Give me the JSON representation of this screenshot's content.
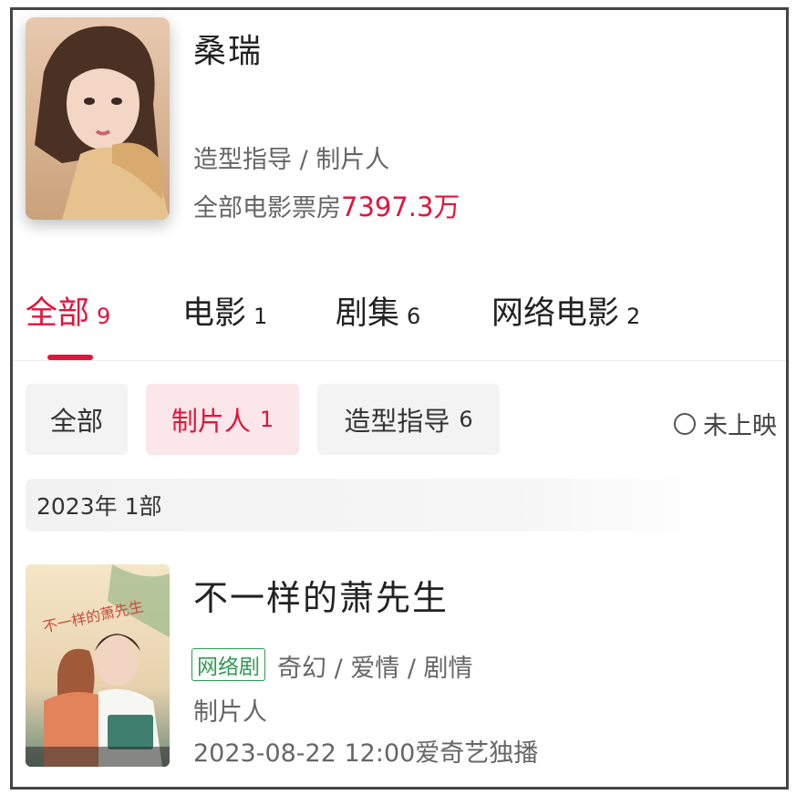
{
  "person": {
    "name": "桑瑞",
    "roles": "造型指导 / 制片人",
    "box_office_label": "全部电影票房",
    "box_office_value": "7397.3万"
  },
  "tabs": [
    {
      "label": "全部",
      "count": "9",
      "active": true
    },
    {
      "label": "电影",
      "count": "1",
      "active": false
    },
    {
      "label": "剧集",
      "count": "6",
      "active": false
    },
    {
      "label": "网络电影",
      "count": "2",
      "active": false
    }
  ],
  "filters": [
    {
      "label": "全部",
      "count": "",
      "active": false
    },
    {
      "label": "制片人",
      "count": "1",
      "active": true
    },
    {
      "label": "造型指导",
      "count": "6",
      "active": false
    }
  ],
  "unreleased_toggle": {
    "label": "未上映",
    "checked": false
  },
  "year_group": {
    "label": "2023年  1部"
  },
  "works": [
    {
      "title": "不一样的萧先生",
      "type_tag": "网络剧",
      "genres": "奇幻 / 爱情 / 剧情",
      "role": "制片人",
      "release": "2023-08-22 12:00爱奇艺独播",
      "poster_text": "不一样的萧先生"
    }
  ],
  "colors": {
    "accent": "#e0153c",
    "tag_green": "#2e9a52",
    "chip_bg": "#f3f3f3",
    "chip_active_bg": "#fbe6e9"
  }
}
